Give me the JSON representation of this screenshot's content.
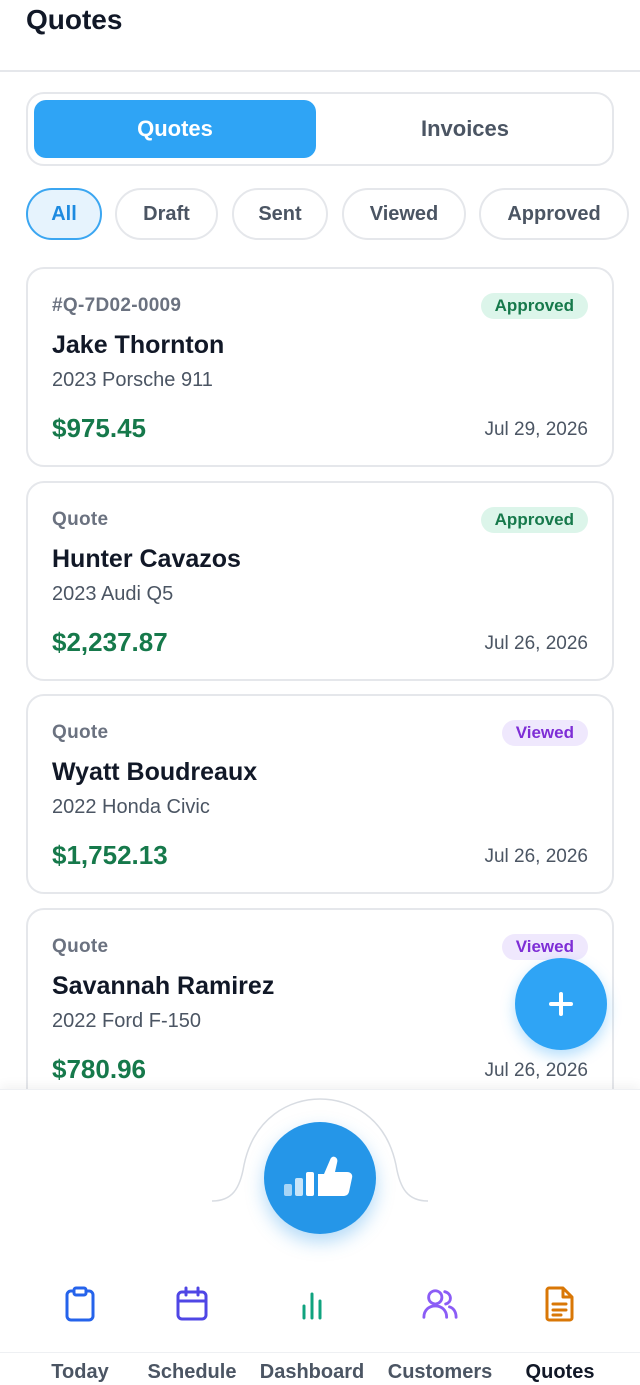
{
  "header": {
    "title": "Quotes"
  },
  "segments": {
    "quotes": "Quotes",
    "invoices": "Invoices"
  },
  "filters": [
    "All",
    "Draft",
    "Sent",
    "Viewed",
    "Approved"
  ],
  "quotes": [
    {
      "id": "#Q-7D02-0009",
      "status": "Approved",
      "name": "Jake Thornton",
      "vehicle": "2023 Porsche 911",
      "amount": "$975.45",
      "date": "Jul 29, 2026"
    },
    {
      "id": "Quote",
      "status": "Approved",
      "name": "Hunter Cavazos",
      "vehicle": "2023 Audi Q5",
      "amount": "$2,237.87",
      "date": "Jul 26, 2026"
    },
    {
      "id": "Quote",
      "status": "Viewed",
      "name": "Wyatt Boudreaux",
      "vehicle": "2022 Honda Civic",
      "amount": "$1,752.13",
      "date": "Jul 26, 2026"
    },
    {
      "id": "Quote",
      "status": "Viewed",
      "name": "Savannah Ramirez",
      "vehicle": "2022 Ford F-150",
      "amount": "$780.96",
      "date": "Jul 26, 2026"
    }
  ],
  "nav": {
    "items": [
      {
        "label": "Today",
        "icon": "clipboard-icon",
        "color": "#2563eb"
      },
      {
        "label": "Schedule",
        "icon": "calendar-icon",
        "color": "#4f46e5"
      },
      {
        "label": "Dashboard",
        "icon": "bar-chart-icon",
        "color": "#10a37f"
      },
      {
        "label": "Customers",
        "icon": "users-icon",
        "color": "#8b5cf6"
      },
      {
        "label": "Quotes",
        "icon": "document-icon",
        "color": "#d97706"
      }
    ],
    "active": "Quotes"
  },
  "colors": {
    "accent": "#2fa4f5",
    "amount": "#16794b",
    "approved_bg": "#dcf5ea",
    "viewed_bg": "#efe8fd"
  }
}
